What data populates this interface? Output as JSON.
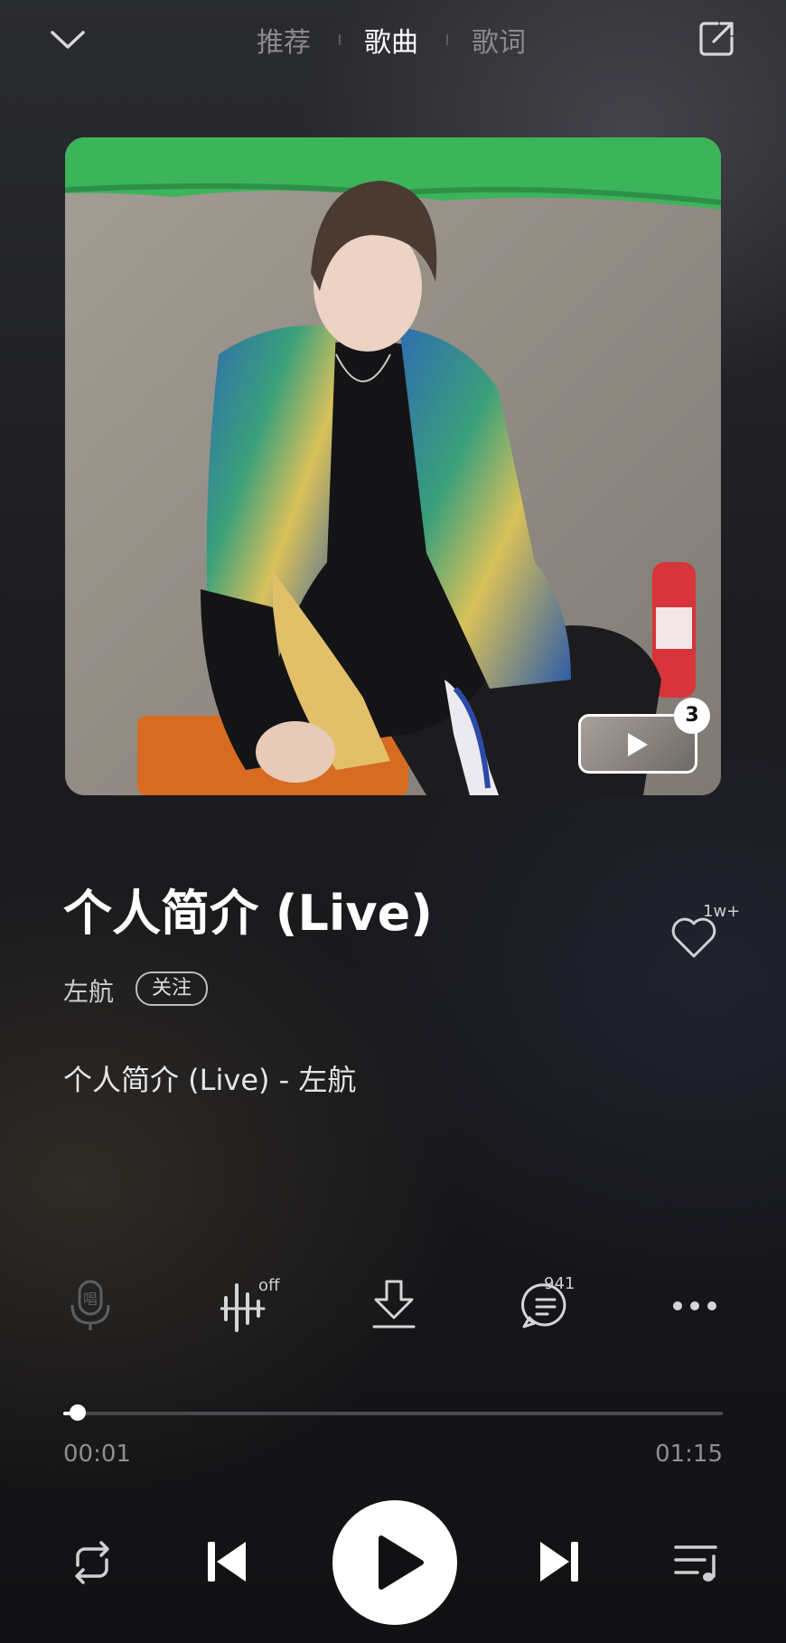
{
  "header": {
    "tabs": [
      {
        "label": "推荐",
        "active": false
      },
      {
        "label": "歌曲",
        "active": true
      },
      {
        "label": "歌词",
        "active": false
      }
    ],
    "collapse_icon": "chevron-down-icon",
    "share_icon": "share-out-icon"
  },
  "cover": {
    "video_count": "3"
  },
  "song": {
    "title": "个人简介 (Live)",
    "artist": "左航",
    "follow_label": "关注",
    "like_count": "1w+",
    "current_lyric": "个人简介 (Live) - 左航"
  },
  "actions": {
    "sing_label": "唱",
    "sound_effect_state": "off",
    "comment_count": "941"
  },
  "progress": {
    "current_time": "00:01",
    "total_time": "01:15",
    "fraction": 0.022
  },
  "colors": {
    "accent": "#ffffff",
    "muted": "#8f8f93"
  }
}
